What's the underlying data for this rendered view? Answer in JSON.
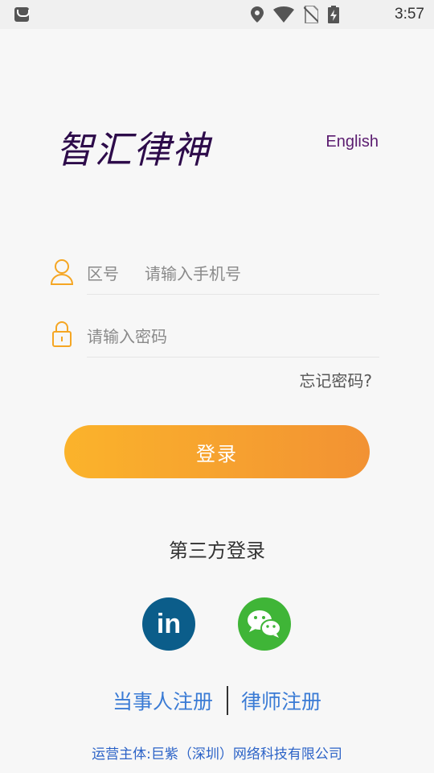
{
  "status_bar": {
    "time": "3:57",
    "icons": [
      "app-icon",
      "location-icon",
      "wifi-icon",
      "no-sim-icon",
      "battery-charging-icon"
    ]
  },
  "header": {
    "app_title": "智汇律神",
    "language_toggle": "English"
  },
  "form": {
    "area_code_label": "区号",
    "phone_placeholder": "请输入手机号",
    "password_placeholder": "请输入密码",
    "forgot_password": "忘记密码?"
  },
  "login_button": {
    "label": "登录",
    "gradient": [
      "#fbb32b",
      "#f29233"
    ]
  },
  "third_party": {
    "title": "第三方登录",
    "providers": [
      {
        "name": "linkedin-icon",
        "glyph": "in",
        "color": "#0b5d8a"
      },
      {
        "name": "wechat-icon",
        "color": "#3fb537"
      }
    ]
  },
  "register": {
    "party_label": "当事人注册",
    "lawyer_label": "律师注册"
  },
  "footer": {
    "operator": "运营主体:巨紫（深圳）网络科技有限公司"
  },
  "colors": {
    "accent": "#f7a62e",
    "title": "#2d0b4a",
    "link": "#3a7bd5"
  }
}
